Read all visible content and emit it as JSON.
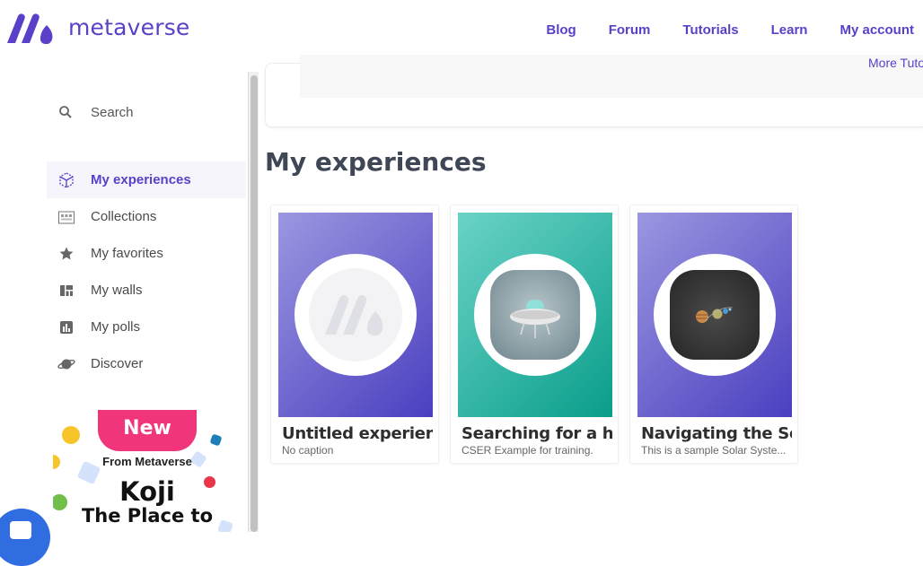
{
  "header": {
    "brand": "metaverse",
    "nav": [
      "Blog",
      "Forum",
      "Tutorials",
      "Learn",
      "My account"
    ]
  },
  "colors": {
    "accent": "#5a3fc8",
    "purple_gradient": [
      "#9c97e0",
      "#4a3fc0"
    ],
    "teal_gradient": [
      "#6bd3c8",
      "#0a9e8a"
    ],
    "promo_pink": "#f0357a",
    "chat_blue": "#2f6de1"
  },
  "sidebar": {
    "search_label": "Search",
    "items": [
      {
        "label": "My experiences",
        "icon": "cube-icon",
        "active": true
      },
      {
        "label": "Collections",
        "icon": "collections-icon",
        "active": false
      },
      {
        "label": "My favorites",
        "icon": "star-icon",
        "active": false
      },
      {
        "label": "My walls",
        "icon": "wall-grid-icon",
        "active": false
      },
      {
        "label": "My polls",
        "icon": "poll-chart-icon",
        "active": false
      },
      {
        "label": "Discover",
        "icon": "planet-icon",
        "active": false
      }
    ],
    "promo": {
      "badge": "New",
      "from": "From Metaverse",
      "headline": "Koji",
      "subline": "The Place to"
    }
  },
  "main": {
    "more_link": "More Tutorials",
    "section_title": "My experiences",
    "cards": [
      {
        "title": "Untitled experience",
        "caption": "No caption",
        "theme": "purple",
        "image": "metaverse-logo-placeholder"
      },
      {
        "title": "Searching for a happy place",
        "caption": "CSER Example for training.",
        "theme": "teal",
        "image": "ufo-image"
      },
      {
        "title": "Navigating the Solar System",
        "caption": "This is a sample Solar Syste...",
        "theme": "purple",
        "image": "solar-system-image"
      }
    ]
  }
}
